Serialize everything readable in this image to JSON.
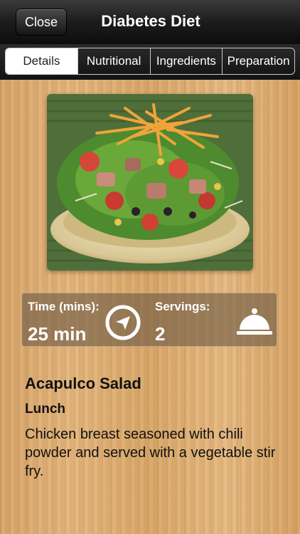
{
  "nav": {
    "close_label": "Close",
    "title": "Diabetes Diet"
  },
  "tabs": [
    {
      "label": "Details",
      "active": true
    },
    {
      "label": "Nutritional",
      "active": false
    },
    {
      "label": "Ingredients",
      "active": false
    },
    {
      "label": "Preparation",
      "active": false
    }
  ],
  "photo": {
    "icon": "salad-photo"
  },
  "info": {
    "time_label": "Time (mins):",
    "time_value": "25 min",
    "servings_label": "Servings:",
    "servings_value": "2",
    "time_icon": "compass-icon",
    "servings_icon": "cloche-icon"
  },
  "recipe": {
    "title": "Acapulco Salad",
    "category": "Lunch",
    "description": "Chicken breast seasoned with chili powder and served with a vegetable stir fry."
  },
  "colors": {
    "navbar": "#1c1c1c",
    "active_tab_bg": "#ffffff",
    "panel": "#6e5a46",
    "wood": "#dca96d"
  }
}
